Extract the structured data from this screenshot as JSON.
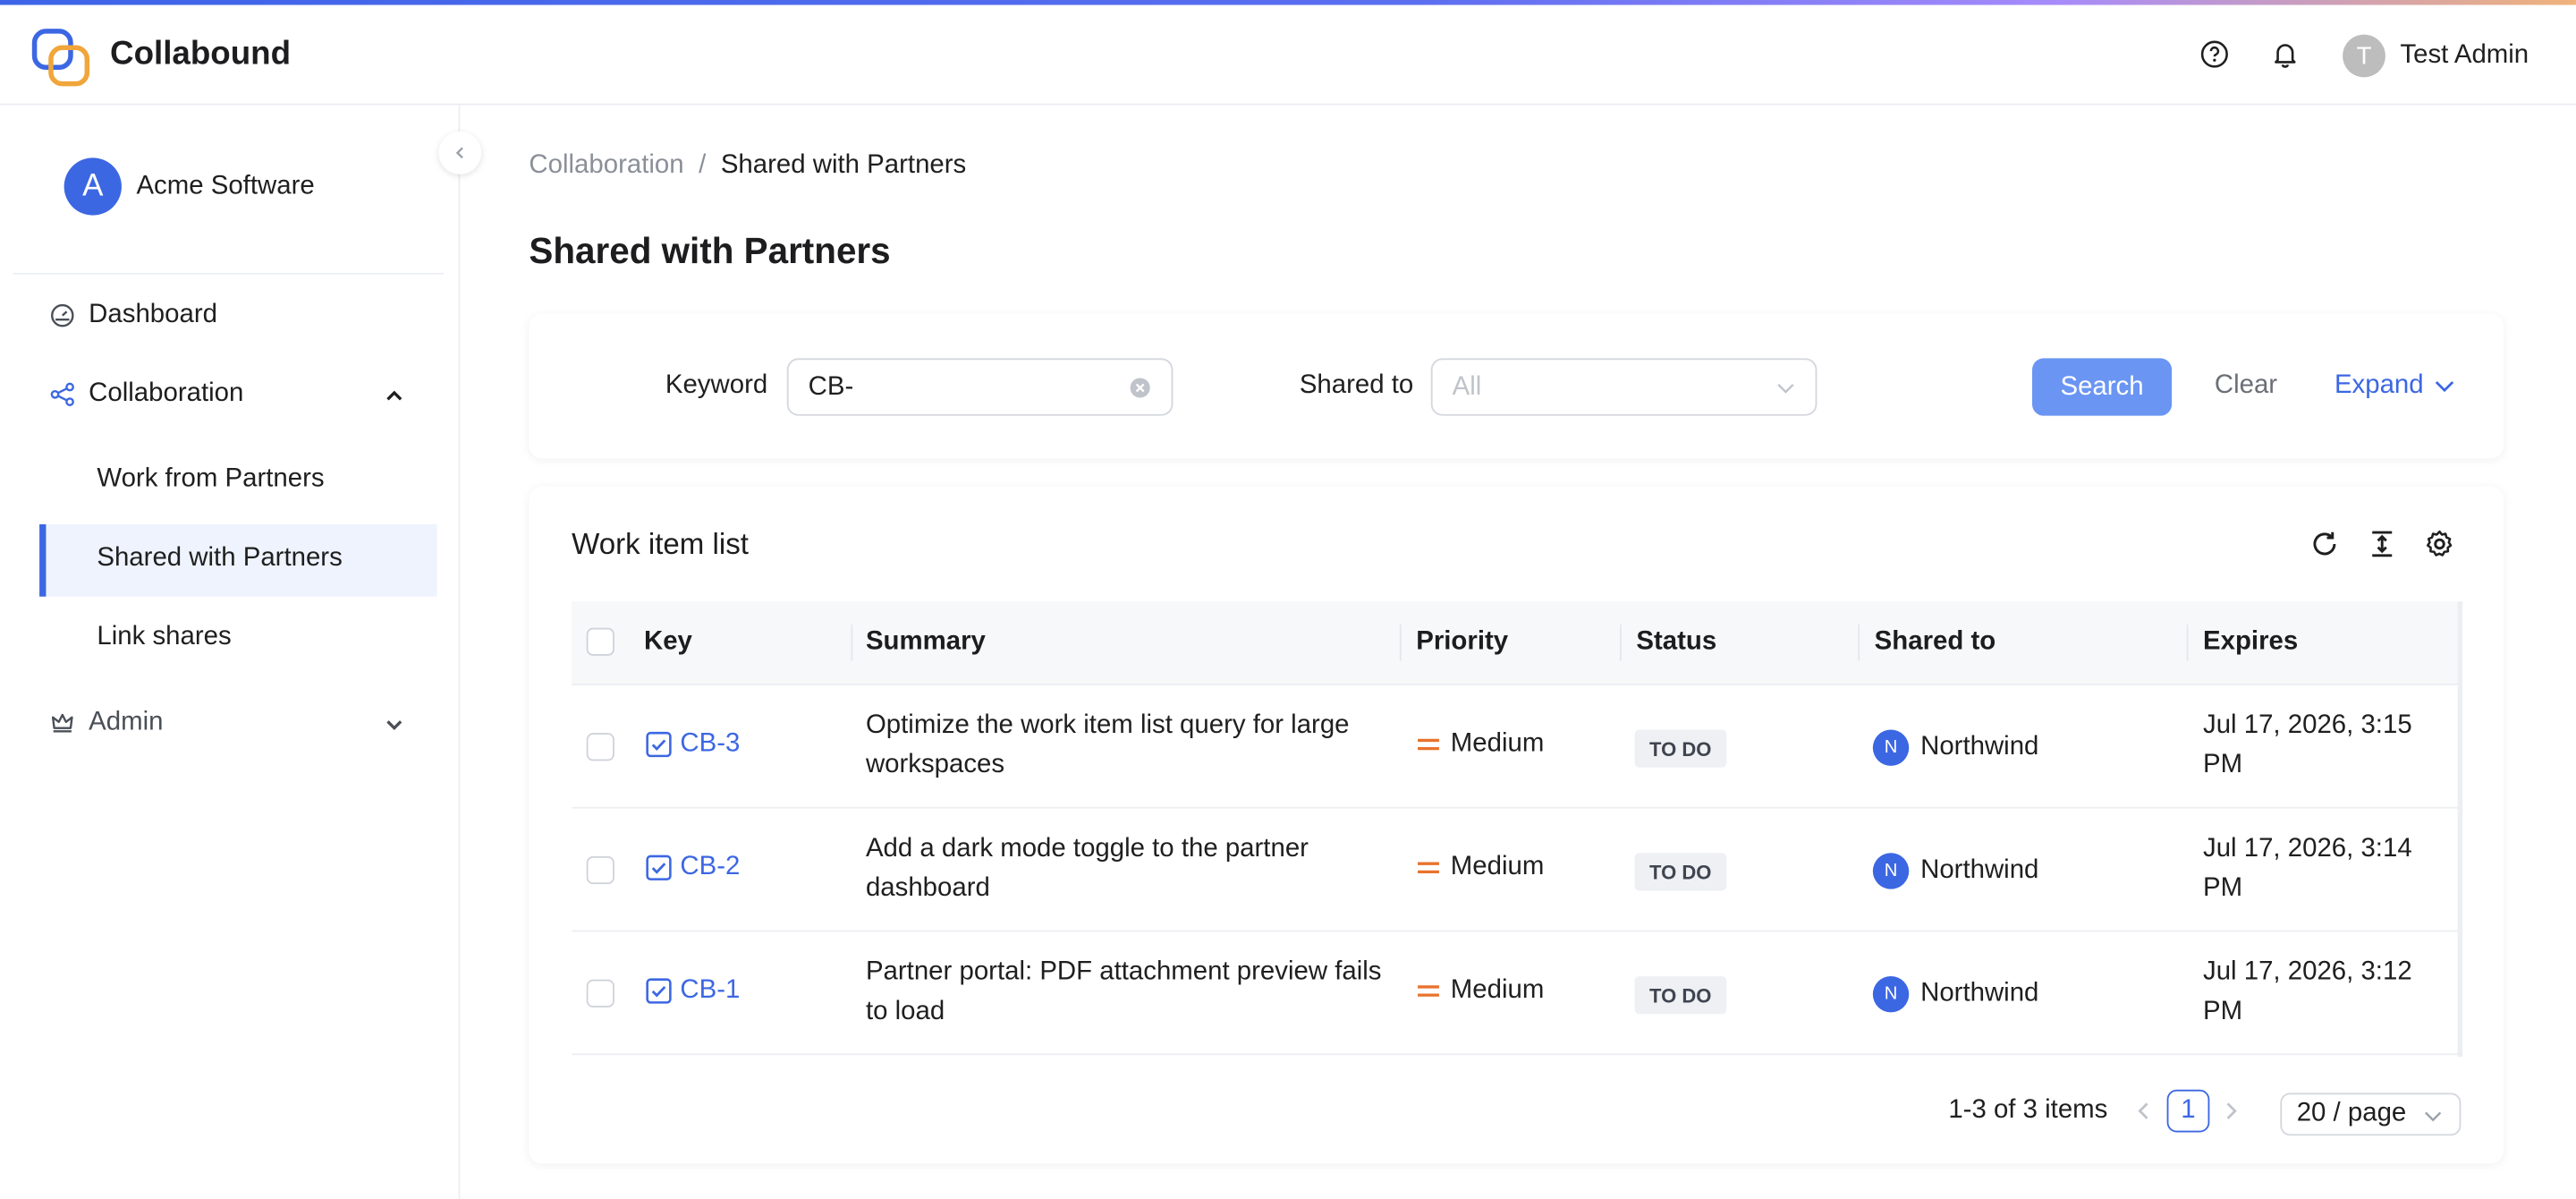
{
  "app": {
    "brand": "Collabound",
    "user_name": "Test Admin",
    "user_initial": "T",
    "accent": "#3c67e3"
  },
  "header_icons": [
    "help-circle-icon",
    "bell-icon"
  ],
  "sidebar": {
    "org_initial": "A",
    "org_name": "Acme Software",
    "dashboard": "Dashboard",
    "collaboration": "Collaboration",
    "sub_items": [
      "Work from Partners",
      "Shared with Partners",
      "Link shares"
    ],
    "admin": "Admin"
  },
  "breadcrumb": {
    "parent": "Collaboration",
    "separator": "/",
    "current": "Shared with Partners"
  },
  "page_title": "Shared with Partners",
  "filters": {
    "keyword_label": "Keyword",
    "keyword_value": "CB-",
    "shared_to_label": "Shared to",
    "shared_to_placeholder": "All",
    "search": "Search",
    "clear": "Clear",
    "expand": "Expand"
  },
  "list": {
    "title": "Work item list",
    "columns": [
      "Key",
      "Summary",
      "Priority",
      "Status",
      "Shared to",
      "Expires"
    ],
    "rows": [
      {
        "key": "CB-3",
        "summary": "Optimize the work item list query for large workspaces",
        "priority": "Medium",
        "status": "TO DO",
        "partner_initial": "N",
        "partner": "Northwind",
        "expires": "Jul 17, 2026, 3:15 PM"
      },
      {
        "key": "CB-2",
        "summary": "Add a dark mode toggle to the partner dashboard",
        "priority": "Medium",
        "status": "TO DO",
        "partner_initial": "N",
        "partner": "Northwind",
        "expires": "Jul 17, 2026, 3:14 PM"
      },
      {
        "key": "CB-1",
        "summary": "Partner portal: PDF attachment preview fails to load",
        "priority": "Medium",
        "status": "TO DO",
        "partner_initial": "N",
        "partner": "Northwind",
        "expires": "Jul 17, 2026, 3:12 PM"
      }
    ]
  },
  "pagination": {
    "total": "1-3 of 3 items",
    "page": "1",
    "page_size": "20 / page"
  }
}
